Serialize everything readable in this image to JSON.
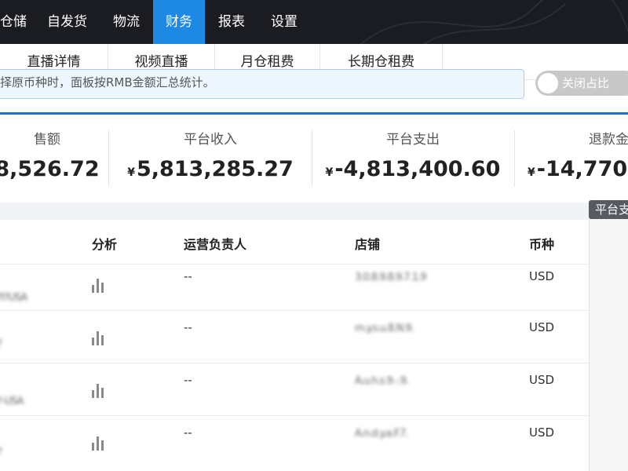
{
  "nav": {
    "items": [
      "仓储",
      "自发货",
      "物流",
      "财务",
      "报表",
      "设置"
    ],
    "active": "财务"
  },
  "subtabs": [
    "直播详情",
    "视频直播",
    "月仓租费",
    "长期仓租费"
  ],
  "notice": {
    "text": "择原币种时，面板按RMB金额汇总统计。",
    "toggle_label": "关闭占比"
  },
  "stats": [
    {
      "label": "售额",
      "currency": "",
      "value": "8,526.72"
    },
    {
      "label": "平台收入",
      "currency": "¥",
      "value": "5,813,285.27"
    },
    {
      "label": "平台支出",
      "currency": "¥",
      "value": "-4,813,400.60"
    },
    {
      "label": "退款金",
      "currency": "¥",
      "value": "-14,770,"
    }
  ],
  "tag": "平台支",
  "table": {
    "headers": [
      "分析",
      "运营负责人",
      "店铺",
      "币种"
    ],
    "rows": [
      {
        "name": "?l?USA",
        "analysis": "bar-chart-icon",
        "manager": "--",
        "shop": "3.0.8.9.8.9.7.1.9",
        "currency": "USD"
      },
      {
        "name": "?",
        "analysis": "bar-chart-icon",
        "manager": "--",
        "shop": "m.y.s.u.8.N.9.",
        "currency": "USD"
      },
      {
        "name": "?-USA",
        "analysis": "bar-chart-icon",
        "manager": "--",
        "shop": "A.u.h.s.9.-.9.",
        "currency": "USD"
      },
      {
        "name": "?",
        "analysis": "bar-chart-icon",
        "manager": "--",
        "shop": "A.n.d.y.a.F.7.",
        "currency": "USD"
      }
    ]
  },
  "colors": {
    "nav_bg": "#1a1c22",
    "accent": "#1e88e5",
    "rule": "#1e6fd0"
  }
}
